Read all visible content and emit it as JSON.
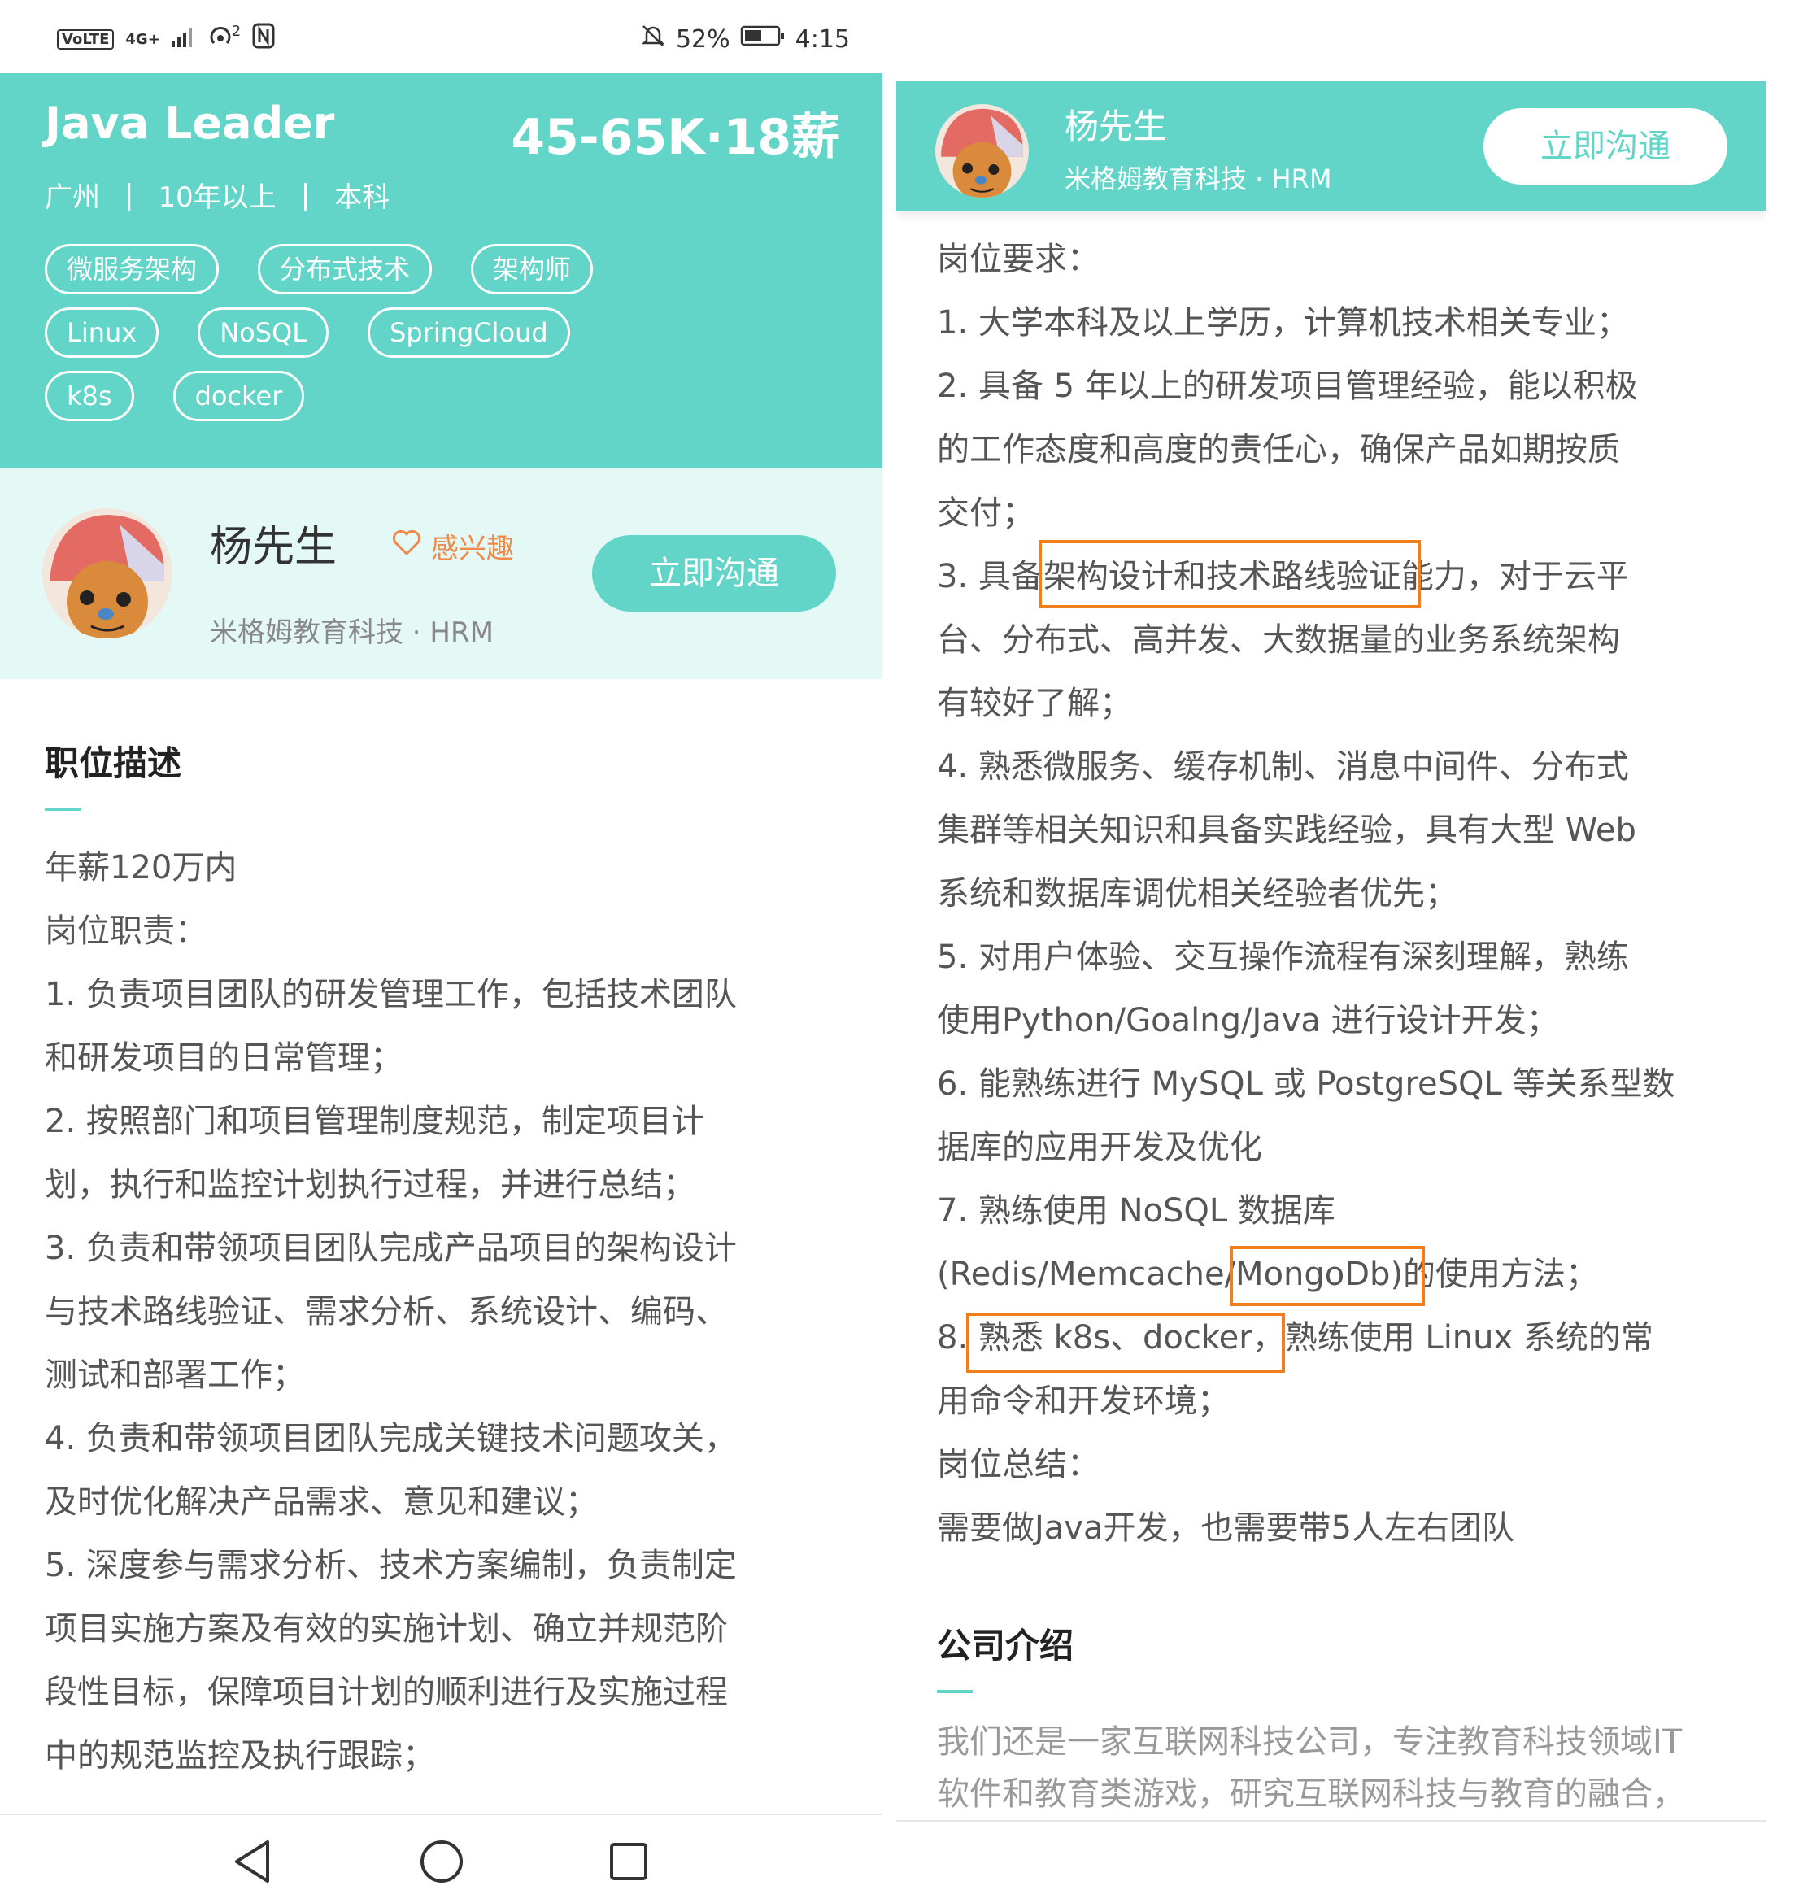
{
  "status_bar": {
    "network_badge": "VoLTE",
    "signal_label": "4G+",
    "hotspot_count": "2",
    "battery_percent": "52%",
    "time": "4:15"
  },
  "job": {
    "title": "Java Leader",
    "salary": "45-65K·18薪",
    "city": "广州",
    "experience": "10年以上",
    "education": "本科",
    "tags": [
      [
        "微服务架构",
        "分布式技术",
        "架构师"
      ],
      [
        "Linux",
        "NoSQL",
        "SpringCloud"
      ],
      [
        "k8s",
        "docker"
      ]
    ]
  },
  "recruiter": {
    "name": "杨先生",
    "company": "米格姆教育科技 · HRM",
    "interest_label": "感兴趣",
    "chat_button": "立即沟通"
  },
  "description": {
    "title": "职位描述",
    "left_lines": [
      "年薪120万内",
      "岗位职责：",
      "1. 负责项目团队的研发管理工作，包括技术团队",
      "和研发项目的日常管理；",
      "2. 按照部门和项目管理制度规范，制定项目计",
      "划，执行和监控计划执行过程，并进行总结；",
      "3. 负责和带领项目团队完成产品项目的架构设计",
      "与技术路线验证、需求分析、系统设计、编码、",
      "测试和部署工作；",
      "4. 负责和带领项目团队完成关键技术问题攻关，",
      "及时优化解决产品需求、意见和建议；",
      "5. 深度参与需求分析、技术方案编制，负责制定",
      "项目实施方案及有效的实施计划、确立并规范阶",
      "段性目标，保障项目计划的顺利进行及实施过程",
      "中的规范监控及执行跟踪；"
    ],
    "right_lines": [
      "岗位要求：",
      "1. 大学本科及以上学历，计算机技术相关专业；",
      "2. 具备 5 年以上的研发项目管理经验，能以积极",
      "的工作态度和高度的责任心，确保产品如期按质",
      "交付；",
      "3. 具备架构设计和技术路线验证能力，对于云平",
      "台、分布式、高并发、大数据量的业务系统架构",
      "有较好了解；",
      "4. 熟悉微服务、缓存机制、消息中间件、分布式",
      "集群等相关知识和具备实践经验，具有大型 Web",
      "系统和数据库调优相关经验者优先；",
      "5. 对用户体验、交互操作流程有深刻理解，熟练",
      "使用Python/Goalng/Java 进行设计开发；",
      "6. 能熟练进行 MySQL 或 PostgreSQL 等关系型数",
      "据库的应用开发及优化",
      "7. 熟练使用 NoSQL 数据库",
      "(Redis/Memcache/MongoDb)的使用方法；",
      "8. 熟悉 k8s、docker，熟练使用 Linux 系统的常",
      "用命令和开发环境；",
      "岗位总结：",
      "需要做Java开发，也需要带5人左右团队"
    ]
  },
  "company_intro": {
    "title": "公司介绍",
    "lines": [
      "我们还是一家互联网科技公司，专注教育科技领域IT",
      "软件和教育类游戏，研究互联网科技与教育的融合，"
    ]
  },
  "colors": {
    "accent": "#62d5c8",
    "recruiter_bg": "#e4f9f6",
    "interest": "#f08a4b",
    "highlight": "#f07e1a"
  },
  "icons": {
    "nav": [
      "back-icon",
      "home-icon",
      "recents-icon"
    ],
    "interest": "heart-outline-icon"
  }
}
